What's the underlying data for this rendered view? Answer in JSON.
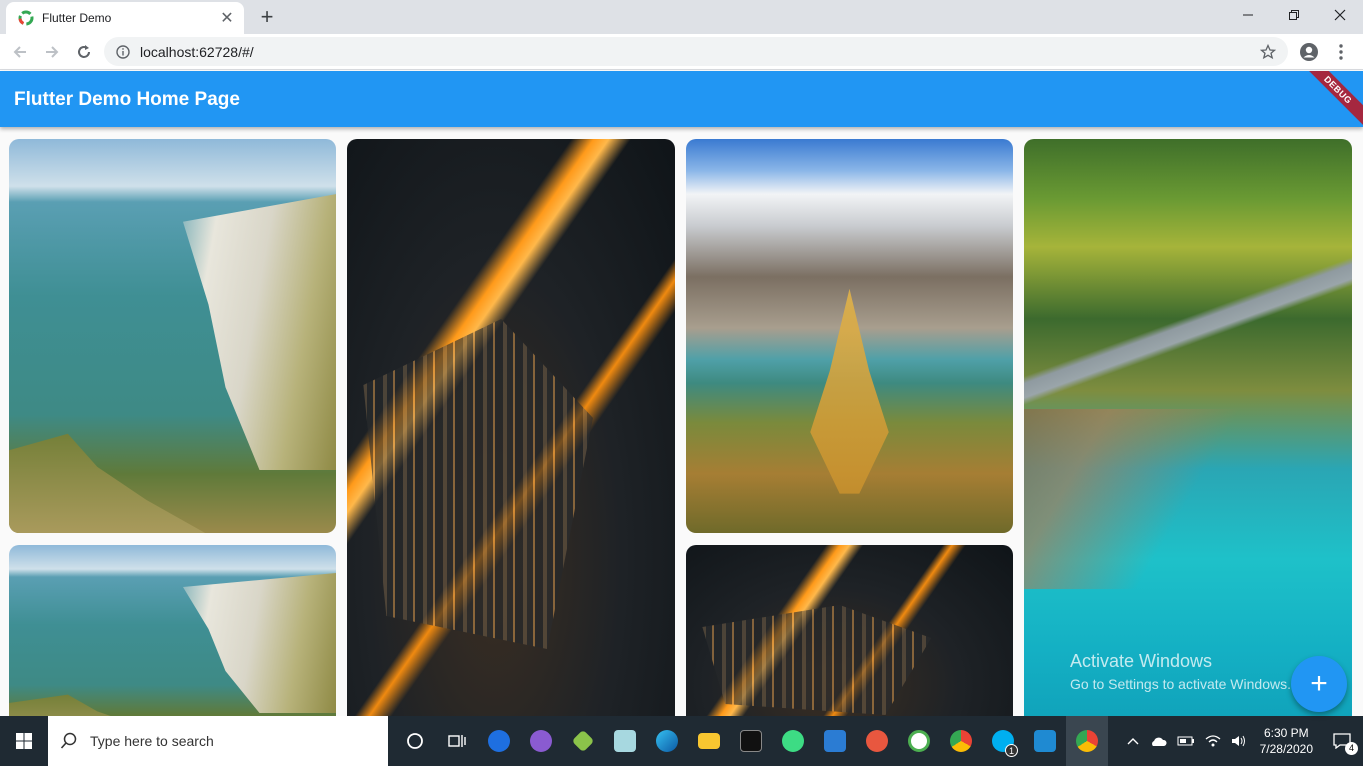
{
  "browser": {
    "tab_title": "Flutter Demo",
    "new_tab_symbol": "+",
    "url": "localhost:62728/#/"
  },
  "app": {
    "title": "Flutter Demo Home Page",
    "debug_label": "DEBUG",
    "fab_symbol": "+",
    "primary_color": "#2196f3",
    "images": [
      {
        "name": "cliffs",
        "column": 1
      },
      {
        "name": "city-night",
        "column": 2
      },
      {
        "name": "mountain-lake",
        "column": 3
      },
      {
        "name": "coast-aerial",
        "column": 4
      },
      {
        "name": "cliffs",
        "column": 1
      },
      {
        "name": "city-night",
        "column": 3
      }
    ]
  },
  "watermark": {
    "line1": "Activate Windows",
    "line2": "Go to Settings to activate Windows."
  },
  "taskbar": {
    "search_placeholder": "Type here to search",
    "skype_badge": "1",
    "time": "6:30 PM",
    "date": "7/28/2020",
    "notification_count": "4"
  }
}
